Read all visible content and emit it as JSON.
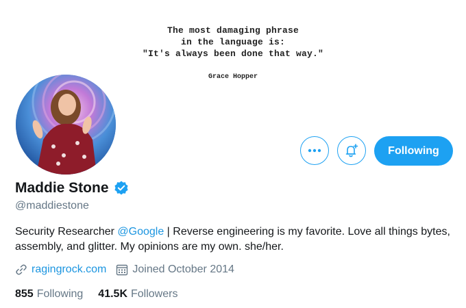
{
  "banner": {
    "quote_lines": [
      "The most damaging phrase",
      "in the language is:",
      "\"It's always been done that way.\""
    ],
    "attribution": "Grace Hopper"
  },
  "actions": {
    "more_icon": "more-horizontal-icon",
    "notify_icon": "bell-plus-icon",
    "follow_label": "Following"
  },
  "profile": {
    "display_name": "Maddie Stone",
    "verified_icon": "verified-badge-icon",
    "handle": "@maddiestone",
    "bio_part1": "Security Researcher ",
    "bio_mention": "@Google",
    "bio_part2": " | Reverse engineering is my favorite. Love all things bytes, assembly, and glitter. My opinions are my own. she/her.",
    "website": "ragingrock.com",
    "joined": "Joined October 2014"
  },
  "stats": {
    "following_count": "855",
    "following_label": "Following",
    "followers_count": "41.5K",
    "followers_label": "Followers"
  },
  "colors": {
    "accent": "#1da1f2",
    "link": "#1b95e0",
    "muted": "#657786"
  }
}
